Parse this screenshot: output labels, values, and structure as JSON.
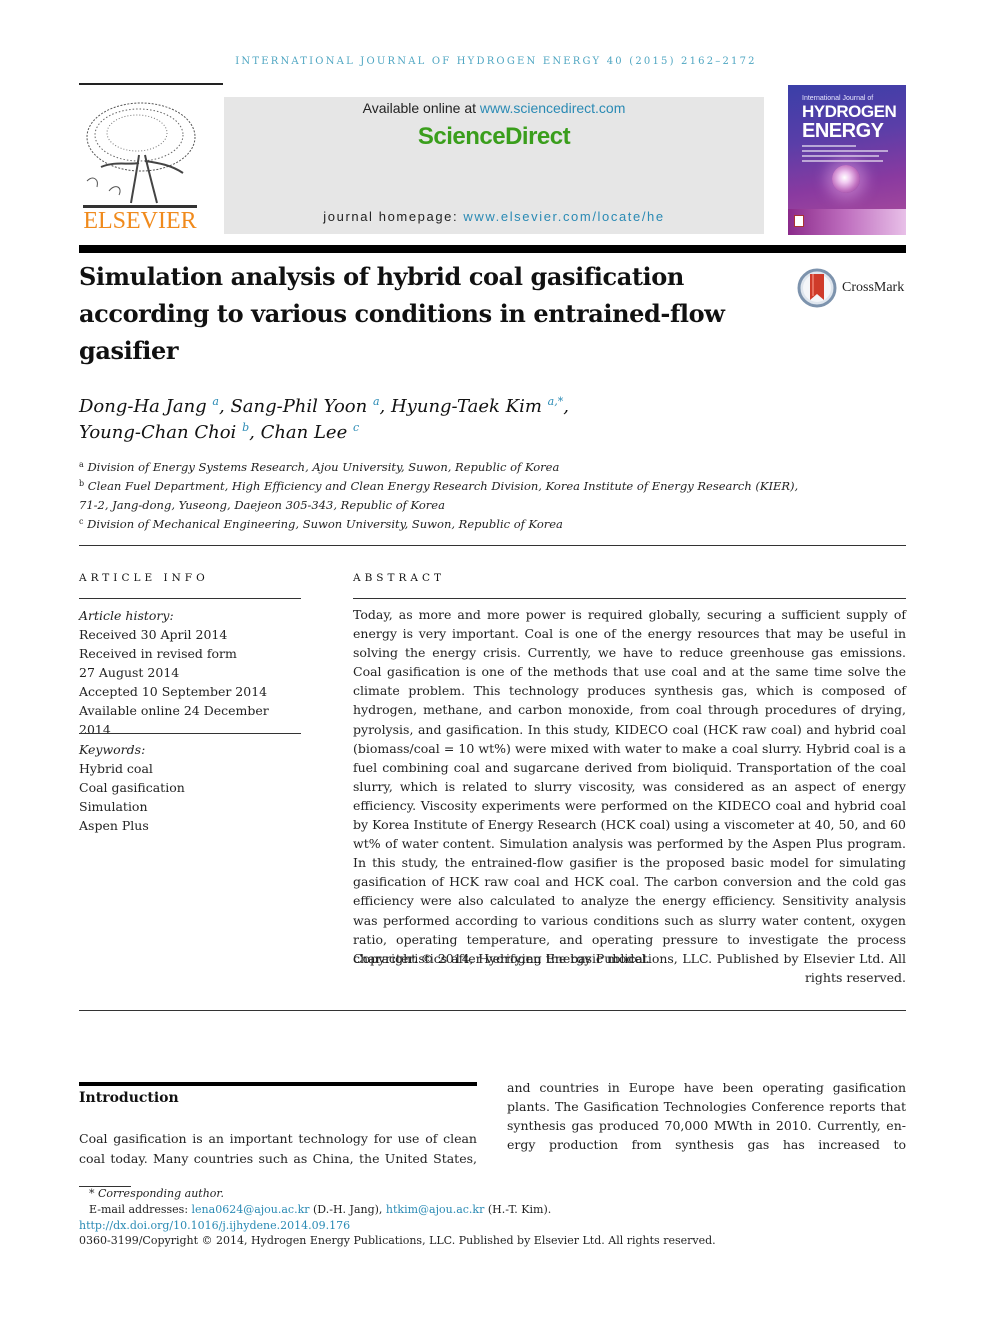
{
  "header": {
    "journal_citation": "International Journal of Hydrogen Energy 40 (2015) 2162–2172",
    "publisher_logo_text": "ELSEVIER",
    "available_online_prefix": "Available online at ",
    "available_online_link": "www.sciencedirect.com",
    "brand": "ScienceDirect",
    "homepage_prefix": "journal homepage: ",
    "homepage_link": "www.elsevier.com/locate/he",
    "cover": {
      "small_title": "International Journal of",
      "title_line1": "HYDROGEN",
      "title_line2": "ENERGY"
    },
    "colors": {
      "link": "#2a8ab4",
      "brand_green": "#3a9e1c",
      "elsevier_orange": "#f08a1c",
      "journal_line": "#4fa6c2"
    }
  },
  "article": {
    "title": "Simulation analysis of hybrid coal gasification according to various conditions in entrained-flow gasifier",
    "crossmark_label": "CrossMark",
    "authors": [
      {
        "name": "Dong-Ha Jang",
        "sup": "a",
        "sep": ", "
      },
      {
        "name": "Sang-Phil Yoon",
        "sup": "a",
        "sep": ", "
      },
      {
        "name": "Hyung-Taek Kim",
        "sup": "a,*",
        "sep": ","
      },
      {
        "name": "Young-Chan Choi",
        "sup": "b",
        "sep": ", "
      },
      {
        "name": "Chan Lee",
        "sup": "c",
        "sep": ""
      }
    ],
    "affiliations": [
      {
        "key": "a",
        "text": "Division of Energy Systems Research, Ajou University, Suwon, Republic of Korea"
      },
      {
        "key": "b",
        "text": "Clean Fuel Department, High Efficiency and Clean Energy Research Division, Korea Institute of Energy Research (KIER), 71-2, Jang-dong, Yuseong, Daejeon 305-343, Republic of Korea"
      },
      {
        "key": "c",
        "text": "Division of Mechanical Engineering, Suwon University, Suwon, Republic of Korea"
      }
    ]
  },
  "article_info": {
    "heading": "ARTICLE INFO",
    "history_label": "Article history:",
    "history": [
      "Received 30 April 2014",
      "Received in revised form",
      "27 August 2014",
      "Accepted 10 September 2014",
      "Available online 24 December 2014"
    ],
    "keywords_label": "Keywords:",
    "keywords": [
      "Hybrid coal",
      "Coal gasification",
      "Simulation",
      "Aspen Plus"
    ]
  },
  "abstract": {
    "heading": "ABSTRACT",
    "text": "Today, as more and more power is required globally, securing a sufficient supply of energy is very important. Coal is one of the energy resources that may be useful in solving the energy crisis. Currently, we have to reduce greenhouse gas emissions. Coal gasification is one of the methods that use coal and at the same time solve the climate problem. This technology produces synthesis gas, which is composed of hydrogen, methane, and carbon monoxide, from coal through procedures of drying, pyrolysis, and gasification. In this study, KIDECO coal (HCK raw coal) and hybrid coal (biomass/coal = 10 wt%) were mixed with water to make a coal slurry. Hybrid coal is a fuel combining coal and sugarcane derived from bioliquid. Transportation of the coal slurry, which is related to slurry vis­cosity, was considered as an aspect of energy efficiency. Viscosity experiments were per­formed on the KIDECO coal and hybrid coal by Korea Institute of Energy Research (HCK coal) using a viscometer at 40, 50, and 60 wt% of water content. Simulation analysis was performed by the Aspen Plus program. In this study, the entrained-flow gasifier is the proposed basic model for simulating gasification of HCK raw coal and HCK coal. The carbon conversion and the cold gas efficiency were also calculated to analyze the energy effi­ciency. Sensitivity analysis was performed according to various conditions such as slurry water content, oxygen ratio, operating temperature, and operating pressure to investigate the process characteristics after verifying the basic model.",
    "copyright": "Copyright © 2014, Hydrogen Energy Publications, LLC. Published by Elsevier Ltd. All rights reserved."
  },
  "introduction": {
    "heading": "Introduction",
    "left_text": "Coal gasification is an important technology for use of clean coal today. Many countries such as China, the United States,",
    "right_text": "and countries in Europe have been operating gasification plants. The Gasification Technologies Conference reports that synthesis gas produced 70,000 MWth in 2010. Currently, en­ergy production from synthesis gas has increased to"
  },
  "footnotes": {
    "corresponding_marker": "*",
    "corresponding_label": "Corresponding author.",
    "email_prefix": "E-mail addresses: ",
    "emails": [
      {
        "address": "lena0624@ajou.ac.kr",
        "owner": " (D.-H. Jang), "
      },
      {
        "address": "htkim@ajou.ac.kr",
        "owner": " (H.-T. Kim)."
      }
    ],
    "doi": "http://dx.doi.org/10.1016/j.ijhydene.2014.09.176",
    "issn_copyright": "0360-3199/Copyright © 2014, Hydrogen Energy Publications, LLC. Published by Elsevier Ltd. All rights reserved."
  }
}
